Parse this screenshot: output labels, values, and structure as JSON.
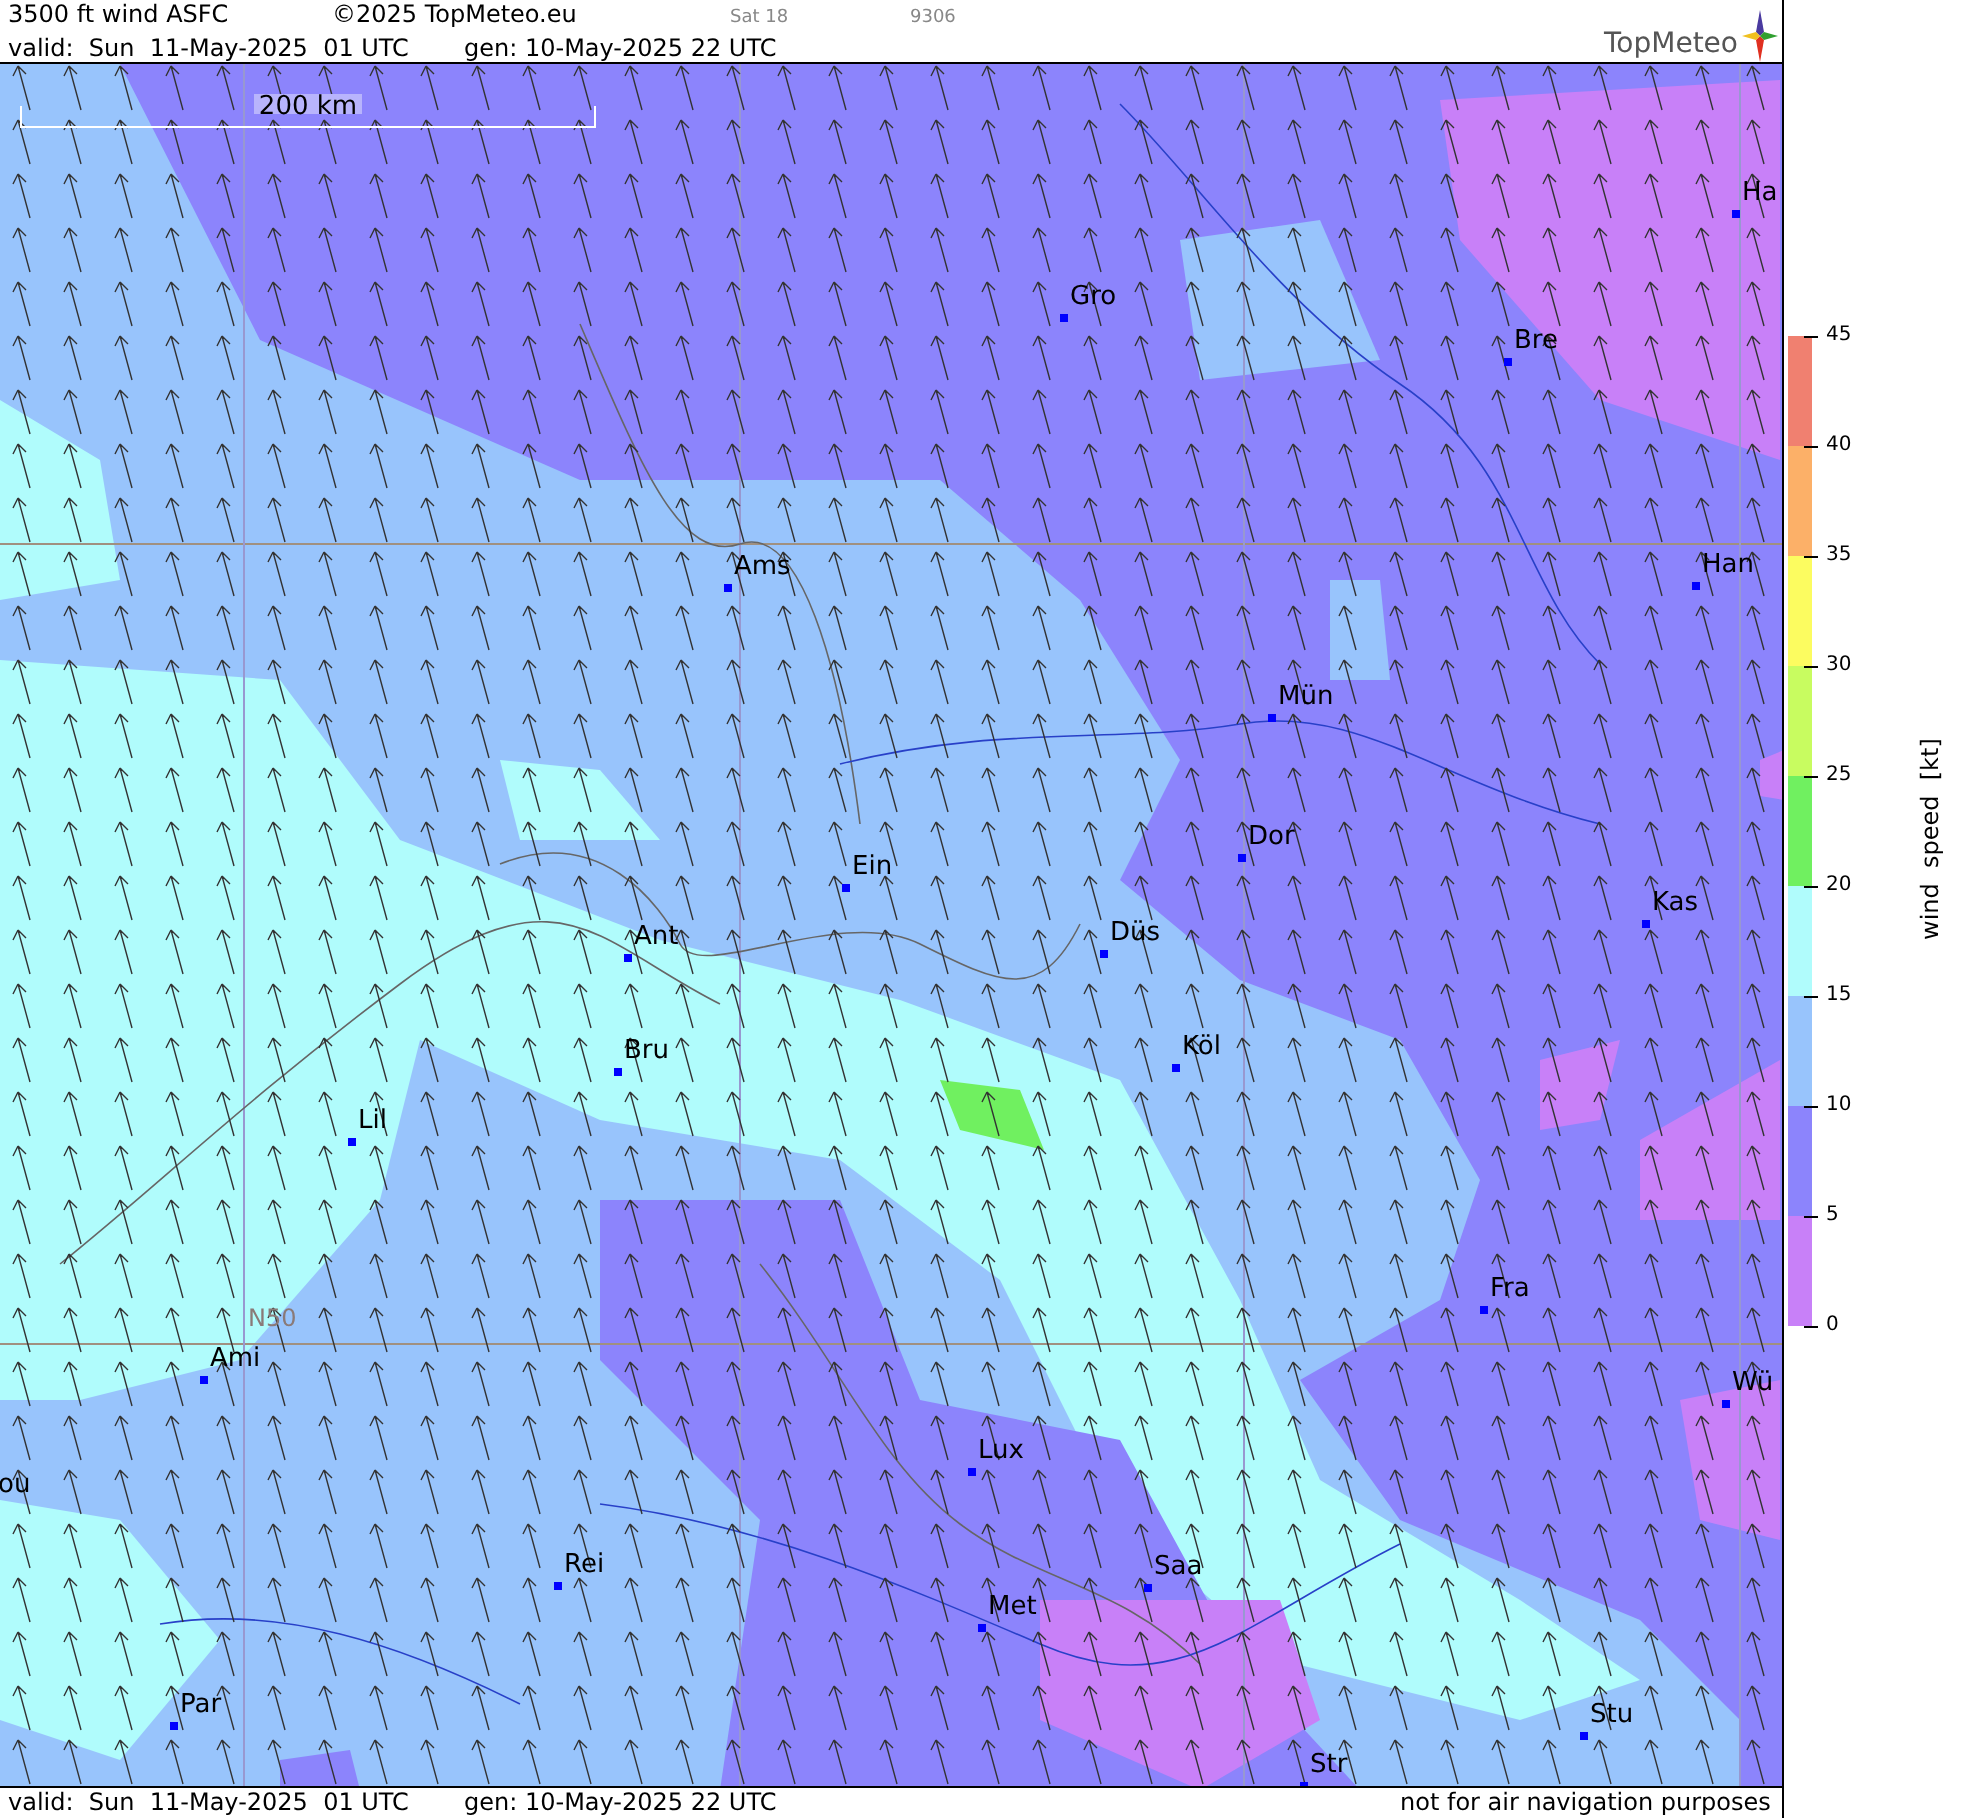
{
  "header": {
    "title": "3500 ft wind ASFC",
    "copyright": "©2025 TopMeteo.eu",
    "satellite": "Sat 18",
    "code": "9306",
    "valid": "valid:  Sun  11-May-2025  01 UTC",
    "generated": "gen: 10-May-2025 22 UTC",
    "logo": "TopMeteo"
  },
  "map": {
    "scale": "200 km",
    "grid_label": "N50",
    "cities": [
      "Ha",
      "Gro",
      "Bre",
      "Ams",
      "Han",
      "Mün",
      "Dor",
      "Ein",
      "Kas",
      "Düs",
      "Ant",
      "Köl",
      "Bru",
      "Lil",
      "Fra",
      "Ami",
      "Wü",
      "Lux",
      "ou",
      "Rei",
      "Saa",
      "Met",
      "Par",
      "Stu",
      "Str"
    ]
  },
  "legend": {
    "title": "wind  speed  [kt]",
    "bands": [
      {
        "color": "#f08070"
      },
      {
        "color": "#fcb068"
      },
      {
        "color": "#fcfc60"
      },
      {
        "color": "#c8fc60"
      },
      {
        "color": "#70f060"
      },
      {
        "color": "#b0fcfc"
      },
      {
        "color": "#98c4fc"
      },
      {
        "color": "#8c84fc"
      },
      {
        "color": "#c880f8"
      }
    ],
    "ticks": [
      "45",
      "40",
      "35",
      "30",
      "25",
      "20",
      "15",
      "10",
      "5",
      "0"
    ]
  },
  "footer": {
    "valid": "valid:  Sun  11-May-2025  01 UTC",
    "generated": "gen: 10-May-2025 22 UTC",
    "disclaimer": "not for air navigation purposes"
  }
}
